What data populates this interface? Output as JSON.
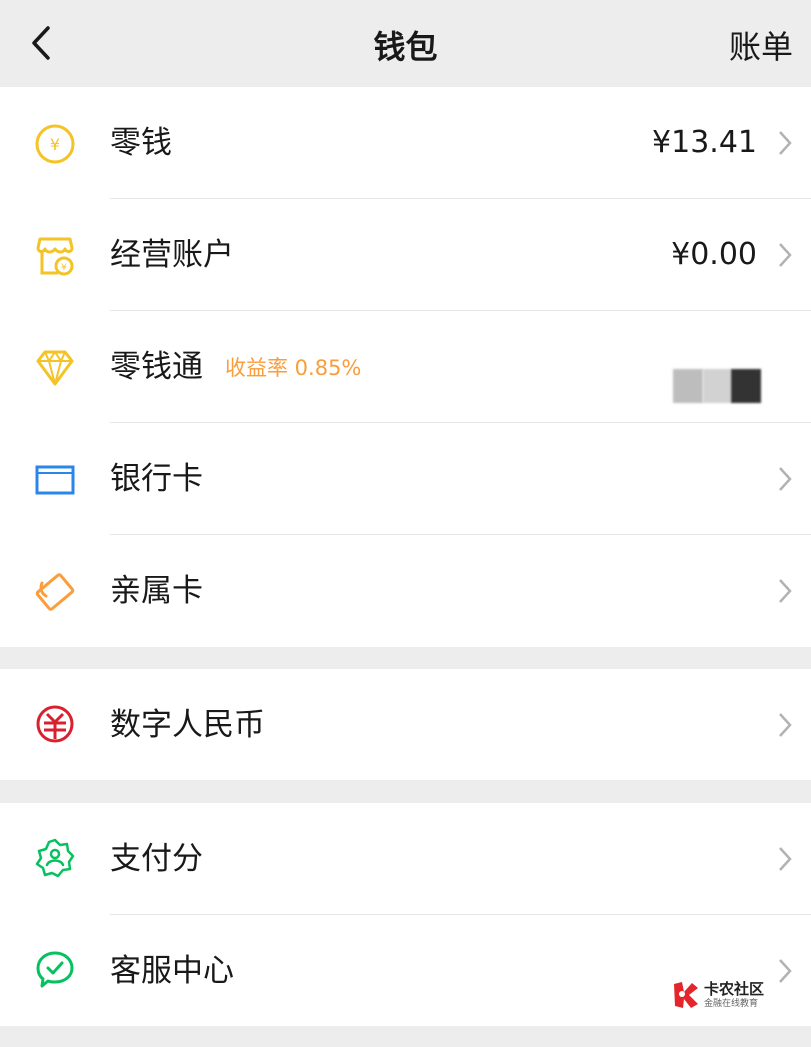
{
  "header": {
    "title": "钱包",
    "right_action": "账单",
    "back_icon": "chevron-left-icon"
  },
  "colors": {
    "accent_orange": "#fa9d3b",
    "green": "#07c160",
    "blue": "#2a86e8",
    "red": "#d8202f",
    "yellow": "#f4c325"
  },
  "groups": [
    {
      "rows": [
        {
          "label": "零钱",
          "value": "¥13.41",
          "icon": "yuan-coin-icon"
        },
        {
          "label": "经营账户",
          "value": "¥0.00",
          "icon": "store-icon"
        },
        {
          "label": "零钱通",
          "sub_label": "收益率 0.85%",
          "value": "",
          "icon": "diamond-icon"
        },
        {
          "label": "银行卡",
          "icon": "bank-card-icon"
        },
        {
          "label": "亲属卡",
          "icon": "family-card-icon"
        }
      ]
    },
    {
      "rows": [
        {
          "label": "数字人民币",
          "icon": "digital-rmb-icon"
        }
      ]
    },
    {
      "rows": [
        {
          "label": "支付分",
          "icon": "pay-score-icon"
        },
        {
          "label": "客服中心",
          "icon": "customer-service-icon"
        }
      ]
    }
  ],
  "watermark": {
    "title": "卡农社区",
    "subtitle": "金融在线教育"
  }
}
